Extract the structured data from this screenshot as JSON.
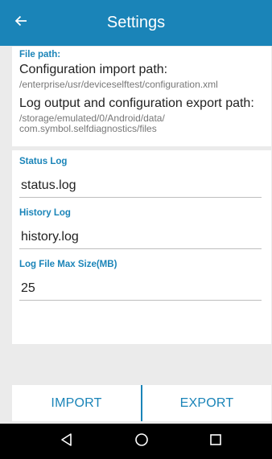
{
  "app_bar": {
    "title": "Settings",
    "back_icon": "arrow-left-icon",
    "color": "#1a84b8"
  },
  "file_path": {
    "label": "File path:",
    "import_heading": "Configuration import path:",
    "import_path": "/enterprise/usr/deviceselftest/configuration.xml",
    "export_heading": "Log output and configuration export path:",
    "export_path_line1": "/storage/emulated/0/Android/data/",
    "export_path_line2": "com.symbol.selfdiagnostics/files"
  },
  "logs": {
    "status_label": "Status Log",
    "status_value": "status.log",
    "history_label": "History Log",
    "history_value": "history.log",
    "max_size_label": "Log File Max Size(MB)",
    "max_size_value": "25"
  },
  "actions": {
    "import_label": "IMPORT",
    "export_label": "EXPORT"
  },
  "nav_bar": {
    "back_icon": "triangle-back-icon",
    "home_icon": "circle-home-icon",
    "recents_icon": "square-recents-icon"
  }
}
